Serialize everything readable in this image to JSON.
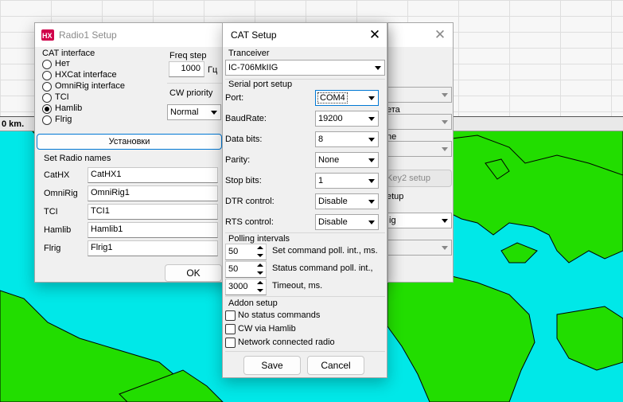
{
  "background": {
    "distance_label": "0 km.",
    "map_colors": {
      "sea": "#00e8e8",
      "land": "#22dd00"
    }
  },
  "back_window": {
    "tab_partial": "ета",
    "row_partial": "ne",
    "button_partial": "Key2 setup",
    "label_partial": "etup",
    "combo_partial": "ig"
  },
  "radio1_setup": {
    "title": "Radio1 Setup",
    "cat_interface_label": "CAT interface",
    "cat_options": [
      {
        "label": "Нет",
        "selected": false
      },
      {
        "label": "HXCat interface",
        "selected": false
      },
      {
        "label": "OmniRig interface",
        "selected": false
      },
      {
        "label": "TCI",
        "selected": false
      },
      {
        "label": "Hamlib",
        "selected": true
      },
      {
        "label": "Flrig",
        "selected": false
      }
    ],
    "freq_step_label": "Freq step",
    "freq_step_value": "1000",
    "freq_step_unit": "Гц",
    "cw_priority_label": "CW priority",
    "cw_priority_value": "Normal",
    "settings_button": "Установки",
    "set_radio_names_label": "Set Radio names",
    "radio_names": [
      {
        "label": "CatHX",
        "value": "CatHX1"
      },
      {
        "label": "OmniRig",
        "value": "OmniRig1"
      },
      {
        "label": "TCI",
        "value": "TCI1"
      },
      {
        "label": "Hamlib",
        "value": "Hamlib1"
      },
      {
        "label": "Flrig",
        "value": "Flrig1"
      }
    ],
    "ok_button": "OK"
  },
  "cat_setup": {
    "title": "CAT Setup",
    "tranceiver_label": "Tranceiver",
    "tranceiver_value": "IC-706MkIIG",
    "serial_port_label": "Serial port setup",
    "serial_fields": [
      {
        "label": "Port:",
        "value": "COM4"
      },
      {
        "label": "BaudRate:",
        "value": "19200"
      },
      {
        "label": "Data bits:",
        "value": "8"
      },
      {
        "label": "Parity:",
        "value": "None"
      },
      {
        "label": "Stop bits:",
        "value": "1"
      },
      {
        "label": "DTR control:",
        "value": "Disable"
      },
      {
        "label": "RTS control:",
        "value": "Disable"
      }
    ],
    "polling_label": "Polling intervals",
    "polling": [
      {
        "value": "50",
        "label": "Set command poll. int., ms."
      },
      {
        "value": "50",
        "label": "Status command poll. int.,"
      },
      {
        "value": "3000",
        "label": "Timeout, ms."
      }
    ],
    "addon_label": "Addon setup",
    "addons": [
      {
        "label": "No status commands",
        "checked": false
      },
      {
        "label": "CW via Hamlib",
        "checked": false
      },
      {
        "label": "Network connected radio",
        "checked": false
      }
    ],
    "save_button": "Save",
    "cancel_button": "Cancel"
  }
}
